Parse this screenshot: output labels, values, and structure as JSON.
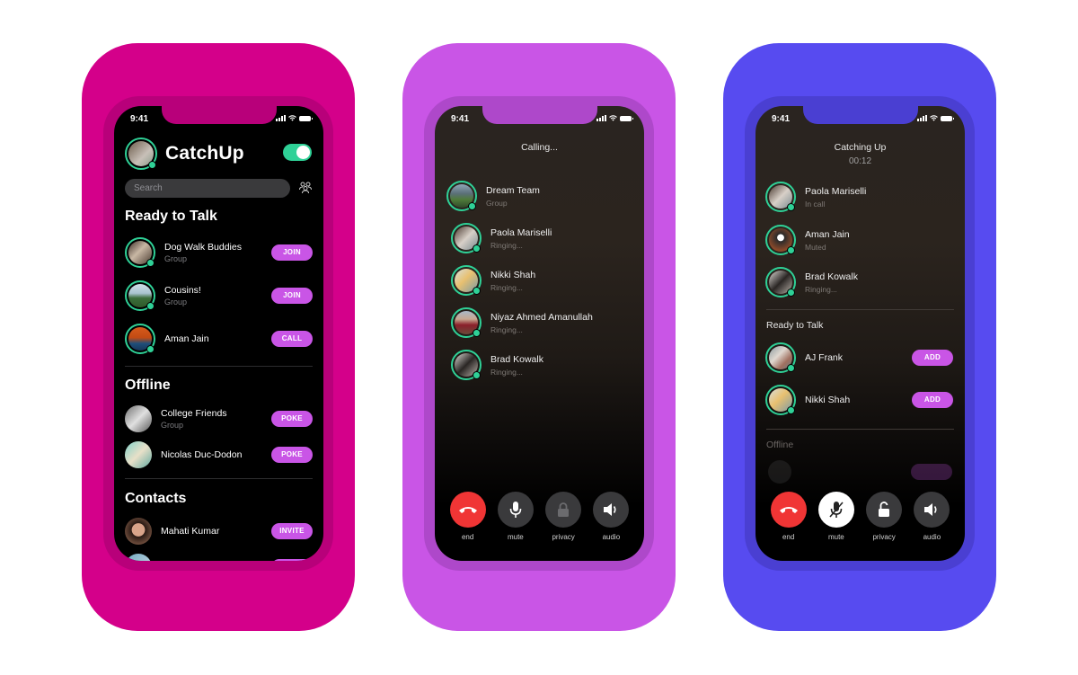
{
  "colors": {
    "card1": "#D4008A",
    "card2": "#C955E6",
    "card3": "#574BF0",
    "online_green": "#2fd197",
    "pill_purple": "#C955E6",
    "end_red": "#f03535"
  },
  "status_bar": {
    "time": "9:41"
  },
  "screen1": {
    "app_title": "CatchUp",
    "toggle_on": true,
    "search_placeholder": "Search",
    "sections": {
      "ready": "Ready to Talk",
      "offline": "Offline",
      "contacts": "Contacts"
    },
    "ready_items": [
      {
        "name": "Dog Walk Buddies",
        "sub": "Group",
        "action": "JOIN"
      },
      {
        "name": "Cousins!",
        "sub": "Group",
        "action": "JOIN"
      },
      {
        "name": "Aman Jain",
        "sub": "",
        "action": "CALL"
      }
    ],
    "offline_items": [
      {
        "name": "College Friends",
        "sub": "Group",
        "action": "POKE"
      },
      {
        "name": "Nicolas Duc-Dodon",
        "sub": "",
        "action": "POKE"
      }
    ],
    "contact_items": [
      {
        "name": "Mahati Kumar",
        "sub": "",
        "action": "INVITE"
      }
    ]
  },
  "screen2": {
    "title": "Calling...",
    "participants": [
      {
        "name": "Dream Team",
        "sub": "Group"
      },
      {
        "name": "Paola Mariselli",
        "sub": "Ringing..."
      },
      {
        "name": "Nikki Shah",
        "sub": "Ringing..."
      },
      {
        "name": "Niyaz Ahmed Amanullah",
        "sub": "Ringing..."
      },
      {
        "name": "Brad Kowalk",
        "sub": "Ringing..."
      }
    ],
    "controls": [
      {
        "label": "end",
        "icon": "phone-hangup-icon"
      },
      {
        "label": "mute",
        "icon": "microphone-icon"
      },
      {
        "label": "privacy",
        "icon": "lock-closed-icon"
      },
      {
        "label": "audio",
        "icon": "speaker-icon"
      }
    ]
  },
  "screen3": {
    "title": "Catching Up",
    "timer": "00:12",
    "participants": [
      {
        "name": "Paola Mariselli",
        "sub": "In call"
      },
      {
        "name": "Aman Jain",
        "sub": "Muted"
      },
      {
        "name": "Brad Kowalk",
        "sub": "Ringing..."
      }
    ],
    "ready_heading": "Ready to Talk",
    "ready_items": [
      {
        "name": "AJ Frank",
        "action": "ADD"
      },
      {
        "name": "Nikki Shah",
        "action": "ADD"
      }
    ],
    "offline_heading": "Offline",
    "controls": [
      {
        "label": "end",
        "icon": "phone-hangup-icon"
      },
      {
        "label": "mute",
        "icon": "microphone-muted-icon",
        "active": true
      },
      {
        "label": "privacy",
        "icon": "lock-open-icon"
      },
      {
        "label": "audio",
        "icon": "speaker-icon"
      }
    ]
  }
}
